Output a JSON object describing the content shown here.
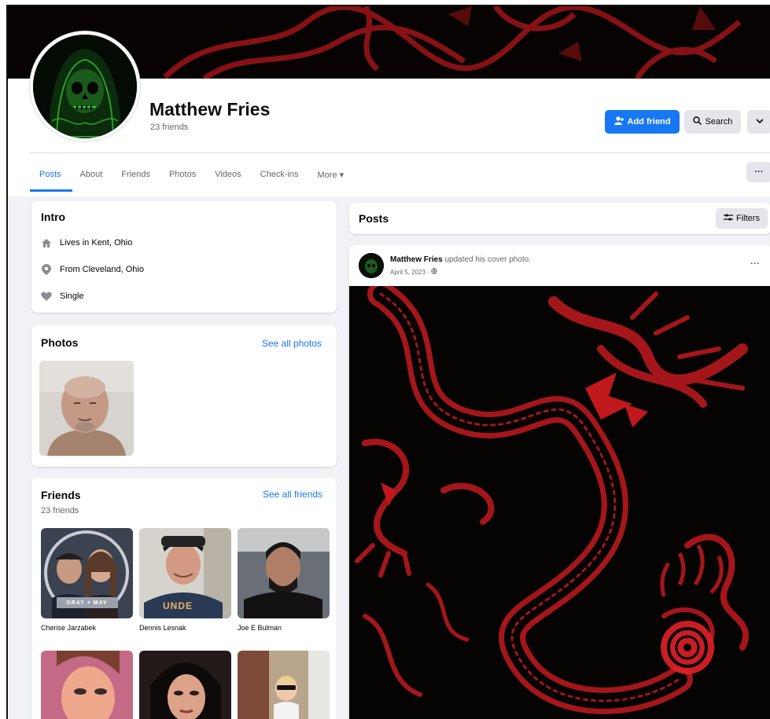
{
  "profile": {
    "name": "Matthew Fries",
    "friend_count": "23 friends"
  },
  "actions": {
    "add_friend": "Add friend",
    "search": "Search",
    "chevron": "⌄"
  },
  "tabs": [
    {
      "label": "Posts"
    },
    {
      "label": "About"
    },
    {
      "label": "Friends"
    },
    {
      "label": "Photos"
    },
    {
      "label": "Videos"
    },
    {
      "label": "Check-ins"
    },
    {
      "label": "More ▾"
    }
  ],
  "tab_more_button": "···",
  "intro": {
    "title": "Intro",
    "items": [
      {
        "icon": "home-icon",
        "text": "Lives in Kent, Ohio"
      },
      {
        "icon": "location-pin-icon",
        "text": "From Cleveland, Ohio"
      },
      {
        "icon": "heart-icon",
        "text": "Single"
      }
    ]
  },
  "photos": {
    "title": "Photos",
    "see_all": "See all photos"
  },
  "friends": {
    "title": "Friends",
    "count": "23 friends",
    "see_all": "See all friends",
    "list": [
      {
        "name": "Cherise Jarzabek"
      },
      {
        "name": "Dennis Lesnak"
      },
      {
        "name": "Joe E Bulman"
      },
      {
        "name": ""
      },
      {
        "name": ""
      },
      {
        "name": ""
      }
    ],
    "tile_caption": "GRAY + MAY",
    "shirt_text": "UNDE"
  },
  "posts": {
    "title": "Posts",
    "filters": "Filters",
    "post": {
      "author": "Matthew Fries",
      "action": "updated his cover photo.",
      "date": "April 5, 2023 ·",
      "more": "···"
    }
  },
  "colors": {
    "brand_blue": "#1877f2",
    "dragon_red": "#b0161a",
    "skull_green": "#2fd12f"
  }
}
